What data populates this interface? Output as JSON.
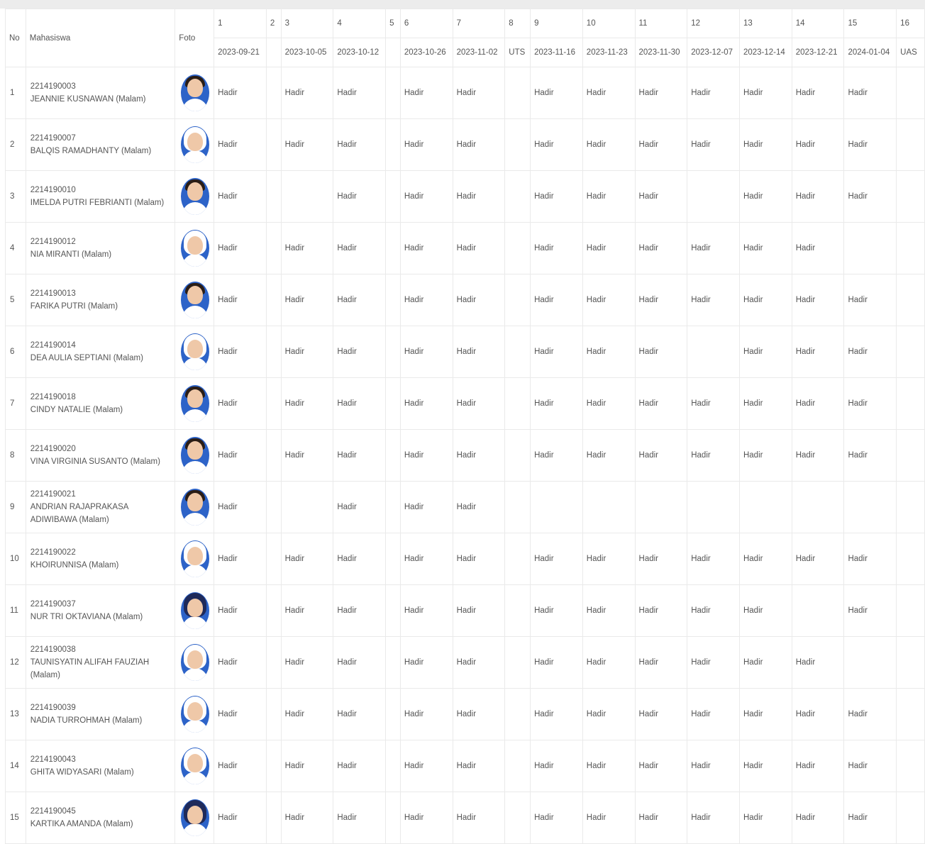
{
  "colors": {
    "avatar_bg": "#2d63c8",
    "border": "#eaeaea",
    "text": "#555555"
  },
  "header": {
    "no": "No",
    "mahasiswa": "Mahasiswa",
    "foto": "Foto",
    "sessions": [
      {
        "num": "1",
        "date": "2023-09-21"
      },
      {
        "num": "2",
        "date": ""
      },
      {
        "num": "3",
        "date": "2023-10-05"
      },
      {
        "num": "4",
        "date": "2023-10-12"
      },
      {
        "num": "5",
        "date": ""
      },
      {
        "num": "6",
        "date": "2023-10-26"
      },
      {
        "num": "7",
        "date": "2023-11-02"
      },
      {
        "num": "8",
        "date": "UTS"
      },
      {
        "num": "9",
        "date": "2023-11-16"
      },
      {
        "num": "10",
        "date": "2023-11-23"
      },
      {
        "num": "11",
        "date": "2023-11-30"
      },
      {
        "num": "12",
        "date": "2023-12-07"
      },
      {
        "num": "13",
        "date": "2023-12-14"
      },
      {
        "num": "14",
        "date": "2023-12-21"
      },
      {
        "num": "15",
        "date": "2024-01-04"
      },
      {
        "num": "16",
        "date": "UAS"
      }
    ]
  },
  "students": [
    {
      "no": "1",
      "nim": "2214190003",
      "name": "JEANNIE KUSNAWAN (Malam)",
      "photo": "student-photo-icon",
      "att": [
        "Hadir",
        "",
        "Hadir",
        "Hadir",
        "",
        "Hadir",
        "Hadir",
        "",
        "Hadir",
        "Hadir",
        "Hadir",
        "Hadir",
        "Hadir",
        "Hadir",
        "Hadir",
        ""
      ]
    },
    {
      "no": "2",
      "nim": "2214190007",
      "name": "BALQIS RAMADHANTY (Malam)",
      "photo": "student-photo-icon",
      "att": [
        "Hadir",
        "",
        "Hadir",
        "Hadir",
        "",
        "Hadir",
        "Hadir",
        "",
        "Hadir",
        "Hadir",
        "Hadir",
        "Hadir",
        "Hadir",
        "Hadir",
        "Hadir",
        ""
      ]
    },
    {
      "no": "3",
      "nim": "2214190010",
      "name": "IMELDA PUTRI FEBRIANTI (Malam)",
      "photo": "student-photo-icon",
      "att": [
        "Hadir",
        "",
        "",
        "Hadir",
        "",
        "Hadir",
        "Hadir",
        "",
        "Hadir",
        "Hadir",
        "Hadir",
        "",
        "Hadir",
        "Hadir",
        "Hadir",
        ""
      ]
    },
    {
      "no": "4",
      "nim": "2214190012",
      "name": "NIA MIRANTI (Malam)",
      "photo": "student-photo-icon",
      "att": [
        "Hadir",
        "",
        "Hadir",
        "Hadir",
        "",
        "Hadir",
        "Hadir",
        "",
        "Hadir",
        "Hadir",
        "Hadir",
        "Hadir",
        "Hadir",
        "Hadir",
        "",
        ""
      ]
    },
    {
      "no": "5",
      "nim": "2214190013",
      "name": "FARIKA PUTRI (Malam)",
      "photo": "student-photo-icon",
      "att": [
        "Hadir",
        "",
        "Hadir",
        "Hadir",
        "",
        "Hadir",
        "Hadir",
        "",
        "Hadir",
        "Hadir",
        "Hadir",
        "Hadir",
        "Hadir",
        "Hadir",
        "Hadir",
        ""
      ]
    },
    {
      "no": "6",
      "nim": "2214190014",
      "name": "DEA AULIA SEPTIANI (Malam)",
      "photo": "student-photo-icon",
      "att": [
        "Hadir",
        "",
        "Hadir",
        "Hadir",
        "",
        "Hadir",
        "Hadir",
        "",
        "Hadir",
        "Hadir",
        "Hadir",
        "",
        "Hadir",
        "Hadir",
        "Hadir",
        ""
      ]
    },
    {
      "no": "7",
      "nim": "2214190018",
      "name": "CINDY NATALIE (Malam)",
      "photo": "student-photo-icon",
      "att": [
        "Hadir",
        "",
        "Hadir",
        "Hadir",
        "",
        "Hadir",
        "Hadir",
        "",
        "Hadir",
        "Hadir",
        "Hadir",
        "Hadir",
        "Hadir",
        "Hadir",
        "Hadir",
        ""
      ]
    },
    {
      "no": "8",
      "nim": "2214190020",
      "name": "VINA VIRGINIA SUSANTO (Malam)",
      "photo": "student-photo-icon",
      "att": [
        "Hadir",
        "",
        "Hadir",
        "Hadir",
        "",
        "Hadir",
        "Hadir",
        "",
        "Hadir",
        "Hadir",
        "Hadir",
        "Hadir",
        "Hadir",
        "Hadir",
        "Hadir",
        ""
      ]
    },
    {
      "no": "9",
      "nim": "2214190021",
      "name": "ANDRIAN RAJAPRAKASA ADIWIBAWA (Malam)",
      "photo": "student-photo-icon",
      "att": [
        "Hadir",
        "",
        "",
        "Hadir",
        "",
        "Hadir",
        "Hadir",
        "",
        "",
        "",
        "",
        "",
        "",
        "",
        "",
        ""
      ]
    },
    {
      "no": "10",
      "nim": "2214190022",
      "name": "KHOIRUNNISA (Malam)",
      "photo": "student-photo-icon",
      "att": [
        "Hadir",
        "",
        "Hadir",
        "Hadir",
        "",
        "Hadir",
        "Hadir",
        "",
        "Hadir",
        "Hadir",
        "Hadir",
        "Hadir",
        "Hadir",
        "Hadir",
        "Hadir",
        ""
      ]
    },
    {
      "no": "11",
      "nim": "2214190037",
      "name": "NUR TRI OKTAVIANA (Malam)",
      "photo": "student-photo-icon",
      "att": [
        "Hadir",
        "",
        "Hadir",
        "Hadir",
        "",
        "Hadir",
        "Hadir",
        "",
        "Hadir",
        "Hadir",
        "Hadir",
        "Hadir",
        "Hadir",
        "",
        "Hadir",
        ""
      ]
    },
    {
      "no": "12",
      "nim": "2214190038",
      "name": "TAUNISYATIN ALIFAH FAUZIAH (Malam)",
      "photo": "student-photo-icon",
      "att": [
        "Hadir",
        "",
        "Hadir",
        "Hadir",
        "",
        "Hadir",
        "Hadir",
        "",
        "Hadir",
        "Hadir",
        "Hadir",
        "Hadir",
        "Hadir",
        "Hadir",
        "",
        ""
      ]
    },
    {
      "no": "13",
      "nim": "2214190039",
      "name": "NADIA TURROHMAH (Malam)",
      "photo": "student-photo-icon",
      "att": [
        "Hadir",
        "",
        "Hadir",
        "Hadir",
        "",
        "Hadir",
        "Hadir",
        "",
        "Hadir",
        "Hadir",
        "Hadir",
        "Hadir",
        "Hadir",
        "Hadir",
        "Hadir",
        ""
      ]
    },
    {
      "no": "14",
      "nim": "2214190043",
      "name": "GHITA WIDYASARI (Malam)",
      "photo": "student-photo-icon",
      "att": [
        "Hadir",
        "",
        "Hadir",
        "Hadir",
        "",
        "Hadir",
        "Hadir",
        "",
        "Hadir",
        "Hadir",
        "Hadir",
        "Hadir",
        "Hadir",
        "Hadir",
        "Hadir",
        ""
      ]
    },
    {
      "no": "15",
      "nim": "2214190045",
      "name": "KARTIKA AMANDA (Malam)",
      "photo": "student-photo-icon",
      "att": [
        "Hadir",
        "",
        "Hadir",
        "Hadir",
        "",
        "Hadir",
        "Hadir",
        "",
        "Hadir",
        "Hadir",
        "Hadir",
        "Hadir",
        "Hadir",
        "Hadir",
        "Hadir",
        ""
      ]
    }
  ]
}
